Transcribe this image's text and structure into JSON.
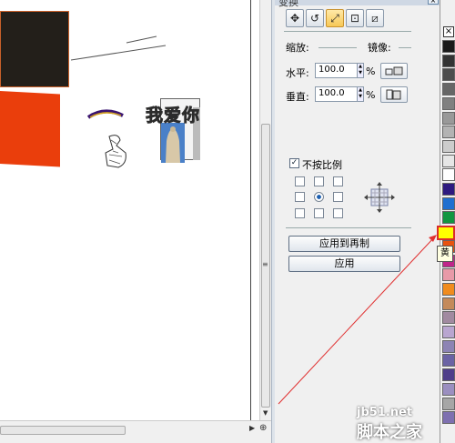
{
  "canvas": {
    "headline_text": "我爱你"
  },
  "docker": {
    "title": "变换",
    "tabs": [
      "position",
      "rotate",
      "scale",
      "size",
      "skew"
    ],
    "scale_label": "缩放:",
    "mirror_label": "镜像:",
    "horizontal_label": "水平:",
    "horizontal_value": "100.0",
    "vertical_label": "垂直:",
    "vertical_value": "100.0",
    "percent": "%",
    "nonproportional_label": "不按比例",
    "nonproportional_checked": true,
    "apply_copy_label": "应用到再制",
    "apply_label": "应用"
  },
  "palette": {
    "no_color_icon": "x-icon",
    "selected_tooltip": "黄",
    "swatches": [
      "#1a1a1a",
      "#333333",
      "#4d4d4d",
      "#666666",
      "#808080",
      "#999999",
      "#b3b3b3",
      "#cccccc",
      "#e6e6e6",
      "#ffffff",
      "#2e1a80",
      "#1f6fd0",
      "#129640",
      "#ffff00",
      "#e8530f",
      "#c0268a",
      "#e89aa8",
      "#f08c1e",
      "#c48a5a",
      "#a18aa0",
      "#b9a6d0",
      "#8d84b4",
      "#6b63a4",
      "#4e3d8a",
      "#9b8fc0",
      "#a6a6a6",
      "#7e70b0"
    ],
    "selected_color": "#ffff00"
  },
  "watermark": {
    "site": "jb51.net",
    "name": "脚本之家"
  }
}
